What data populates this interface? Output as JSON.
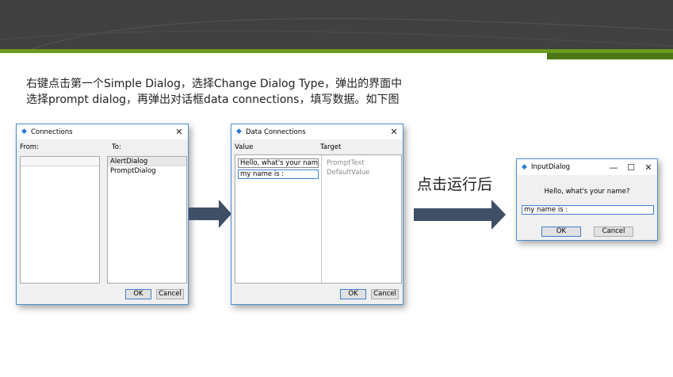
{
  "intro": {
    "line1": "右键点击第一个Simple Dialog，选择Change Dialog Type，弹出的界面中",
    "line2": "选择prompt dialog，再弹出对话框data connections，填写数据。如下图"
  },
  "caption": "点击运行后",
  "colors": {
    "banner": "#414141",
    "accent_green": "#6a9a1f",
    "accent_green_dark": "#4c7514",
    "arrow": "#3f4f66",
    "window_border": "#4a8fd6"
  },
  "connections_dialog": {
    "title": "Connections",
    "icon": "app-window-icon",
    "from_label": "From:",
    "to_label": "To:",
    "to_items": [
      "AlertDialog",
      "PromptDialog"
    ],
    "ok_label": "OK",
    "cancel_label": "Cancel"
  },
  "data_connections_dialog": {
    "title": "Data Connections",
    "icon": "app-window-icon",
    "value_header": "Value",
    "target_header": "Target",
    "values": [
      "Hello, what's your name?",
      "my name is :"
    ],
    "targets": [
      "PromptText",
      "DefaultValue"
    ],
    "ok_label": "OK",
    "cancel_label": "Cancel"
  },
  "input_dialog": {
    "title": "InputDialog",
    "icon": "app-window-icon",
    "prompt_text": "Hello, what's your name?",
    "input_value": "my name is :",
    "ok_label": "OK",
    "cancel_label": "Cancel"
  }
}
